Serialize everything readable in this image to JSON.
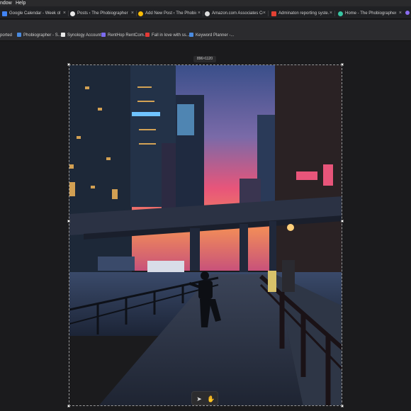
{
  "menubar": {
    "items": [
      "ndow",
      "Help"
    ]
  },
  "tabs": [
    {
      "label": "Google Calendar - Week of ...",
      "color": "#4285f4"
    },
    {
      "label": "Posts ‹ The Phobiographer ...",
      "color": "#e8e8e8"
    },
    {
      "label": "Add New Post ‹ The Phobiog...",
      "color": "#fbbc05"
    },
    {
      "label": "Amazon.com Associates Ce...",
      "color": "#dddddd"
    },
    {
      "label": "Adminaton reporting syste...",
      "color": "#e34133"
    },
    {
      "label": "Home - The Phobiographer",
      "color": "#38c6a3"
    }
  ],
  "tab_close_glyph": "×",
  "bookmarks": [
    {
      "label": "ported",
      "color": ""
    },
    {
      "label": "Phobiographer - S...",
      "color": "#4a8be0"
    },
    {
      "label": "Synology Account",
      "color": "#e8e8e8"
    },
    {
      "label": "RentHop RentCom...",
      "color": "#7c6cf0"
    },
    {
      "label": "Fall in love with ss...",
      "color": "#e53935"
    },
    {
      "label": "Keyword Planner -...",
      "color": "#4a8be0"
    }
  ],
  "canvas": {
    "dimension_label": "896×1120"
  },
  "tools": [
    {
      "icon": "select-arrow-icon",
      "glyph": "➤"
    },
    {
      "icon": "hand-pan-icon",
      "glyph": "✋"
    }
  ],
  "colors": {
    "window_bg": "#1b1b1d",
    "tabstrip_bg": "#202124",
    "accent_sky": "#e8557a"
  }
}
